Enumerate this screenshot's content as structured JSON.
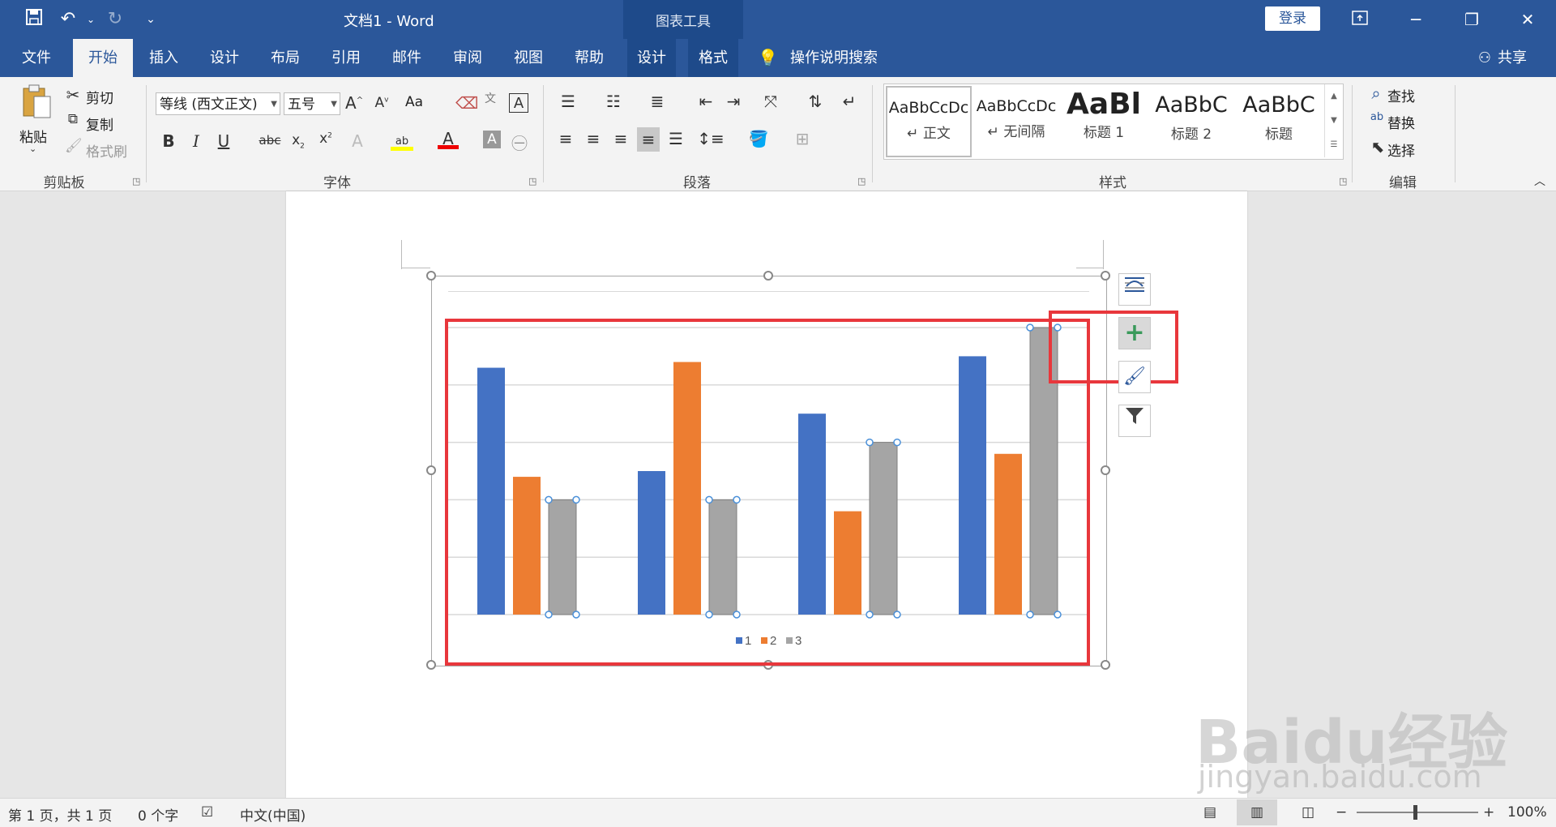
{
  "window": {
    "title": "文档1  -  Word",
    "context_tab_group": "图表工具",
    "login": "登录"
  },
  "tabs": [
    {
      "label": "文件"
    },
    {
      "label": "开始"
    },
    {
      "label": "插入"
    },
    {
      "label": "设计"
    },
    {
      "label": "布局"
    },
    {
      "label": "引用"
    },
    {
      "label": "邮件"
    },
    {
      "label": "审阅"
    },
    {
      "label": "视图"
    },
    {
      "label": "帮助"
    },
    {
      "label": "设计"
    },
    {
      "label": "格式"
    }
  ],
  "tell_me": "操作说明搜索",
  "share": "共享",
  "clipboard": {
    "paste": "粘贴",
    "cut": "剪切",
    "copy": "复制",
    "format_painter": "格式刷",
    "label": "剪贴板"
  },
  "font": {
    "name": "等线 (西文正文)",
    "size": "五号",
    "label": "字体",
    "change_case": "Aa"
  },
  "paragraph": {
    "label": "段落"
  },
  "styles": {
    "label": "样式",
    "items": [
      {
        "sample": "AaBbCcDc",
        "name": "↵ 正文"
      },
      {
        "sample": "AaBbCcDc",
        "name": "↵ 无间隔"
      },
      {
        "sample": "AaBl",
        "name": "标题 1"
      },
      {
        "sample": "AaBbC",
        "name": "标题 2"
      },
      {
        "sample": "AaBbC",
        "name": "标题"
      }
    ]
  },
  "editing": {
    "find": "查找",
    "replace": "替换",
    "select": "选择",
    "label": "编辑"
  },
  "chart_data": {
    "type": "bar",
    "categories": [
      "",
      "",
      "",
      ""
    ],
    "ylim": [
      0,
      5
    ],
    "grid": true,
    "legend": "bottom",
    "series": [
      {
        "name": "1",
        "values": [
          4.3,
          2.5,
          3.5,
          4.5
        ],
        "color": "#4472c4"
      },
      {
        "name": "2",
        "values": [
          2.4,
          4.4,
          1.8,
          2.8
        ],
        "color": "#ed7d31"
      },
      {
        "name": "3",
        "values": [
          2.0,
          2.0,
          3.0,
          5.0
        ],
        "color": "#a5a5a5"
      }
    ]
  },
  "status": {
    "page": "第 1 页，共 1 页",
    "words": "0 个字",
    "language": "中文(中国)",
    "zoom": "100%"
  },
  "watermark": {
    "line1": "Baidu经验",
    "line2": "jingyan.baidu.com"
  }
}
